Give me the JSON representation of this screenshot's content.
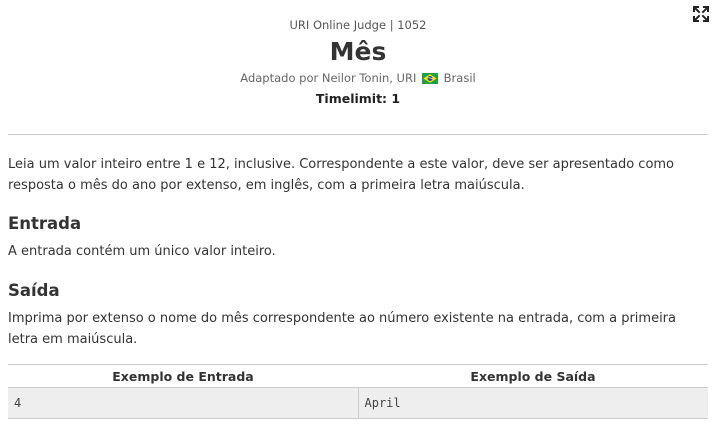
{
  "header": {
    "judge_line": "URI Online Judge | 1052",
    "title": "Mês",
    "author_prefix": "Adaptado por",
    "author_name": "Neilor Tonin, URI",
    "country": "Brasil",
    "flag_icon": "brazil-flag-icon",
    "timelimit": "Timelimit: 1"
  },
  "toolbar": {
    "fullscreen_icon": "fullscreen-icon"
  },
  "description": {
    "text": "Leia um valor inteiro entre 1 e 12, inclusive. Correspondente a este valor, deve ser apresentado como resposta o mês do ano por extenso, em inglês, com a primeira letra maiúscula."
  },
  "input_section": {
    "heading": "Entrada",
    "text": "A entrada contém um único valor inteiro."
  },
  "output_section": {
    "heading": "Saída",
    "text": "Imprima por extenso o nome do mês correspondente ao número existente na entrada, com a primeira letra em maiúscula."
  },
  "examples": {
    "input_header": "Exemplo de Entrada",
    "output_header": "Exemplo de Saída",
    "rows": [
      {
        "input": "4",
        "output": "April"
      }
    ]
  }
}
